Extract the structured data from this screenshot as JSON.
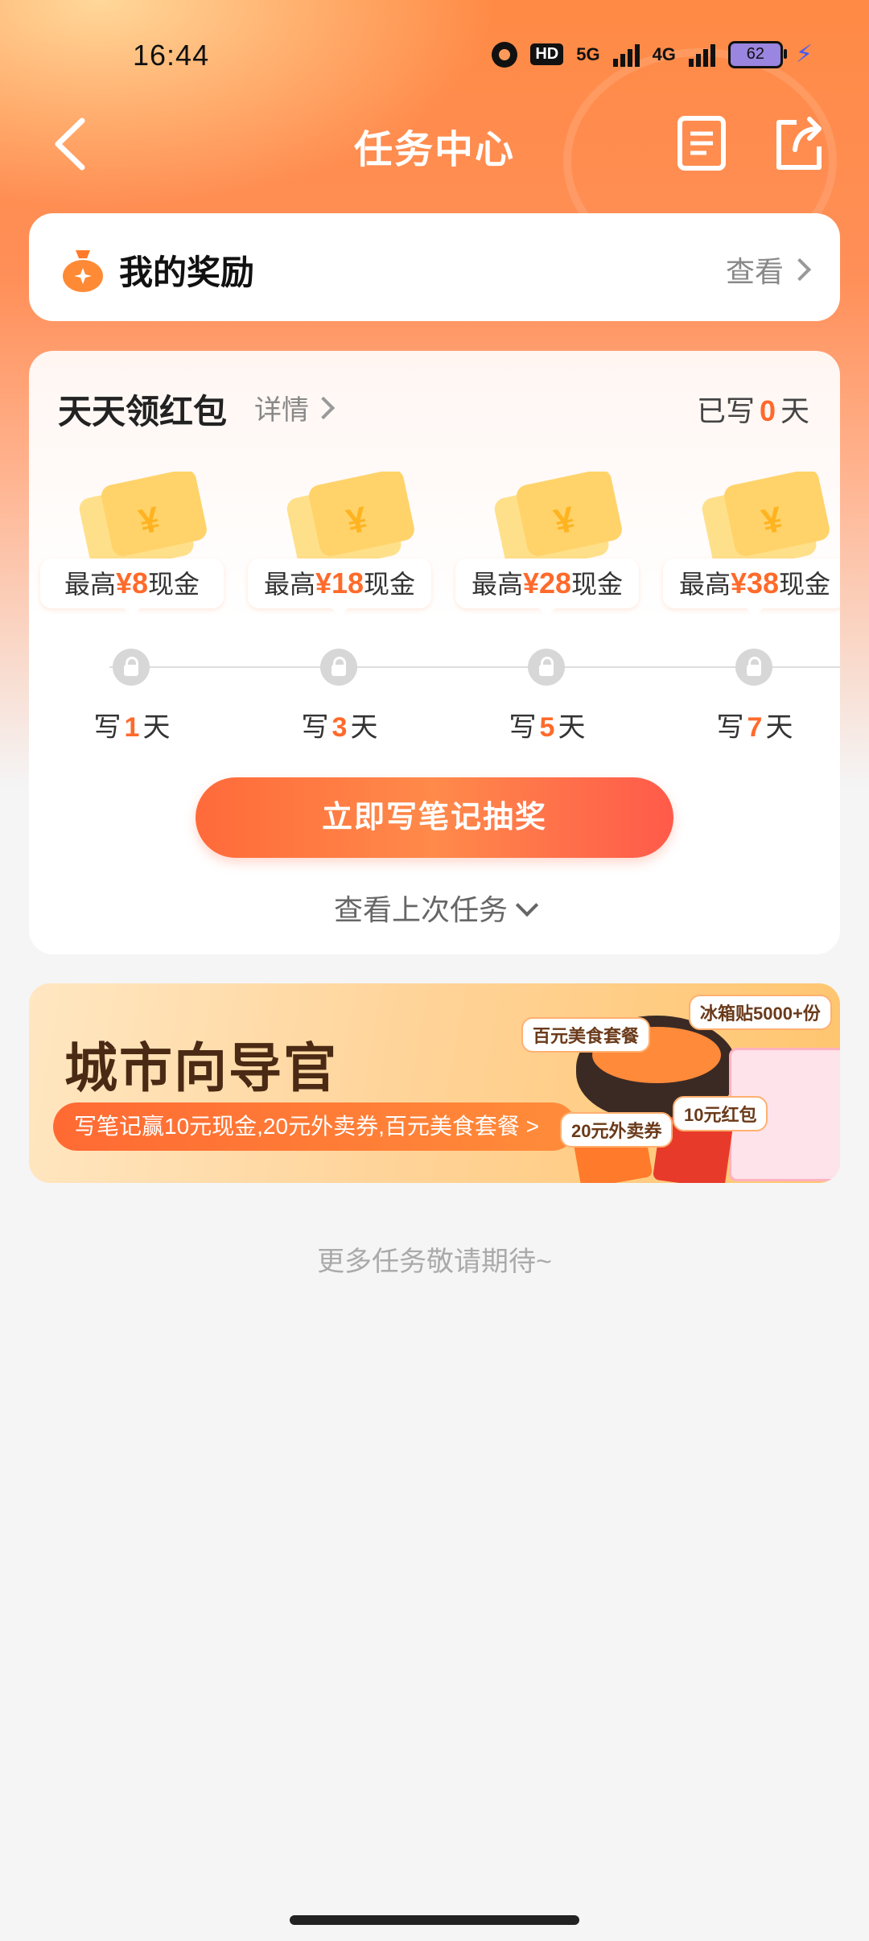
{
  "status_bar": {
    "time": "16:44",
    "hd": "HD",
    "net1": "5G",
    "net2": "4G",
    "battery": "62"
  },
  "header": {
    "title": "任务中心"
  },
  "reward": {
    "title": "我的奖励",
    "view": "查看"
  },
  "daily": {
    "title": "天天领红包",
    "detail": "详情",
    "written_prefix": "已写",
    "written_count": "0",
    "written_suffix": "天",
    "stages": [
      {
        "prize_prefix": "最高",
        "amount": "¥8",
        "prize_suffix": "现金",
        "day_prefix": "写",
        "day": "1",
        "day_suffix": "天"
      },
      {
        "prize_prefix": "最高",
        "amount": "¥18",
        "prize_suffix": "现金",
        "day_prefix": "写",
        "day": "3",
        "day_suffix": "天"
      },
      {
        "prize_prefix": "最高",
        "amount": "¥28",
        "prize_suffix": "现金",
        "day_prefix": "写",
        "day": "5",
        "day_suffix": "天"
      },
      {
        "prize_prefix": "最高",
        "amount": "¥38",
        "prize_suffix": "现金",
        "day_prefix": "写",
        "day": "7",
        "day_suffix": "天"
      }
    ],
    "cta": "立即写笔记抽奖",
    "last_task": "查看上次任务"
  },
  "banner": {
    "title": "城市向导官",
    "subtitle": "写笔记赢10元现金,20元外卖券,百元美食套餐 >",
    "tag_food": "百元美食套餐",
    "tag_fridge": "冰箱贴5000+份",
    "tag_delivery": "20元外卖券",
    "tag_redpack": "10元红包"
  },
  "footer": {
    "more": "更多任务敬请期待~"
  },
  "colors": {
    "accent": "#ff6a2b",
    "header_gradient": "#ff8a45"
  }
}
